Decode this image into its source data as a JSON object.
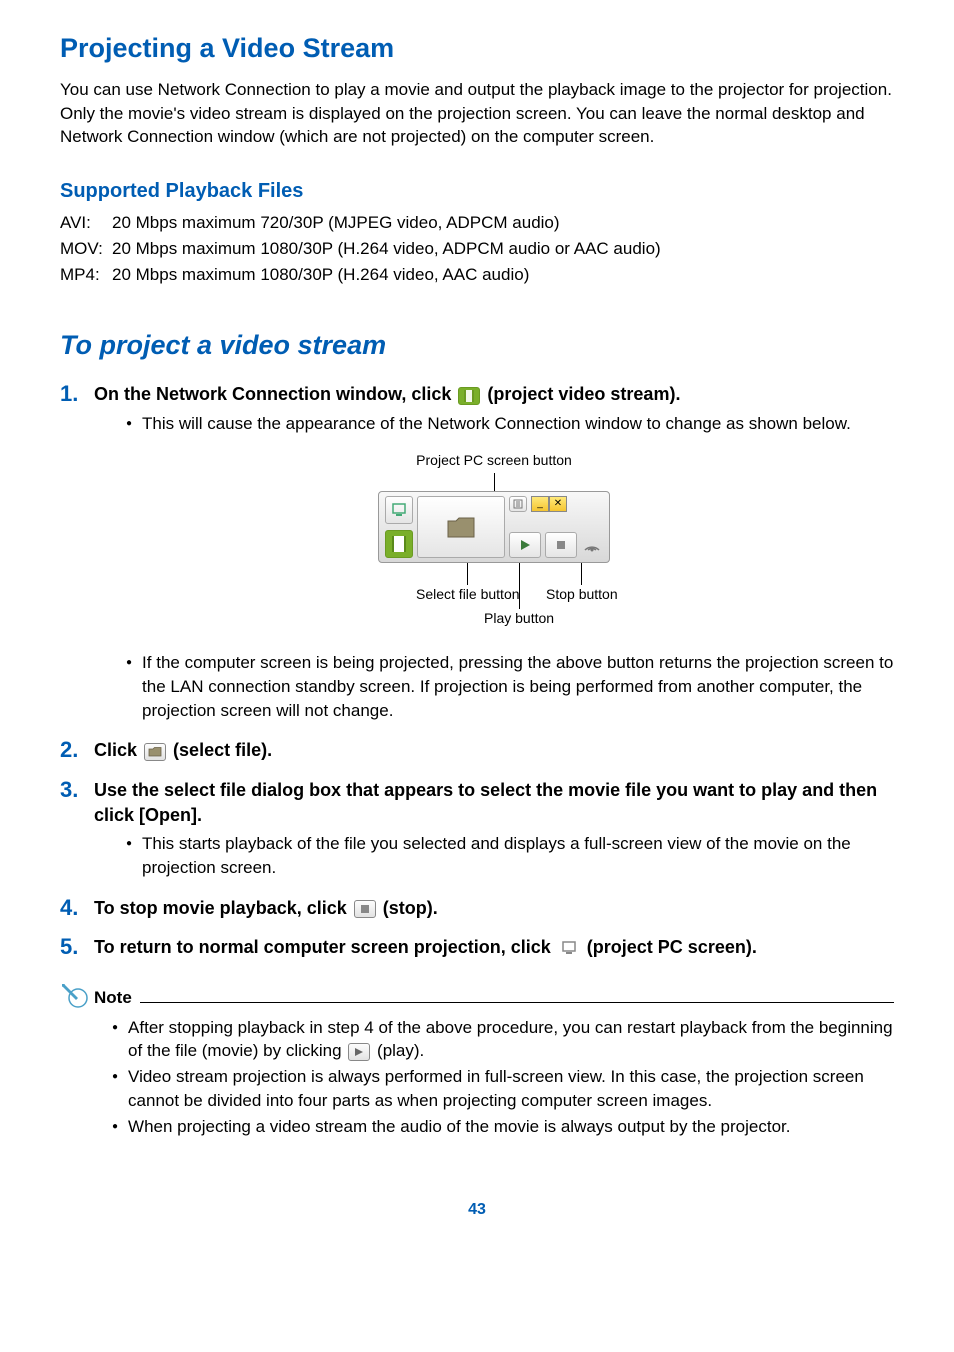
{
  "title": "Projecting a Video Stream",
  "intro": "You can use Network Connection to play a movie and output the playback image to the projector for projection. Only the movie's video stream is displayed on the projection screen. You can leave the normal desktop and Network Connection window (which are not projected) on the computer screen.",
  "supported": {
    "heading": "Supported Playback Files",
    "rows": [
      {
        "label": "AVI:",
        "text": "20 Mbps maximum 720/30P (MJPEG video, ADPCM audio)"
      },
      {
        "label": "MOV:",
        "text": "20 Mbps maximum 1080/30P (H.264 video, ADPCM audio or AAC audio)"
      },
      {
        "label": "MP4:",
        "text": "20 Mbps maximum 1080/30P (H.264 video, AAC audio)"
      }
    ]
  },
  "procedure_heading": "To project a video stream",
  "steps": {
    "s1": {
      "num": "1.",
      "title_a": "On the Network Connection window, click ",
      "title_b": " (project video stream).",
      "b1": "This will cause the appearance of the Network Connection window to change as shown below.",
      "b2": "If the computer screen is being projected, pressing the above button returns the projection screen to the LAN connection standby screen. If projection is being performed from another computer, the projection screen will not change."
    },
    "s2": {
      "num": "2.",
      "title_a": "Click ",
      "title_b": " (select file)."
    },
    "s3": {
      "num": "3.",
      "title": "Use the select file dialog box that appears to select the movie file you want to play and then click [Open].",
      "b1": "This starts playback of the file you selected and displays a full-screen view of the movie on the projection screen."
    },
    "s4": {
      "num": "4.",
      "title_a": "To stop movie playback, click ",
      "title_b": " (stop)."
    },
    "s5": {
      "num": "5.",
      "title_a": "To return to normal computer screen projection, click ",
      "title_b": " (project PC screen)."
    }
  },
  "figure": {
    "top_label": "Project PC screen button",
    "select_label": "Select file button",
    "play_label": "Play button",
    "stop_label": "Stop button"
  },
  "note": {
    "label": "Note",
    "n1a": "After stopping playback in step 4 of the above procedure, you can restart playback from the beginning of the file (movie) by clicking ",
    "n1b": " (play).",
    "n2": "Video stream projection is always performed in full-screen view. In this case, the projection screen cannot be divided into four parts as when projecting computer screen images.",
    "n3": "When projecting a video stream the audio of the movie is always output by the projector."
  },
  "page_number": "43"
}
